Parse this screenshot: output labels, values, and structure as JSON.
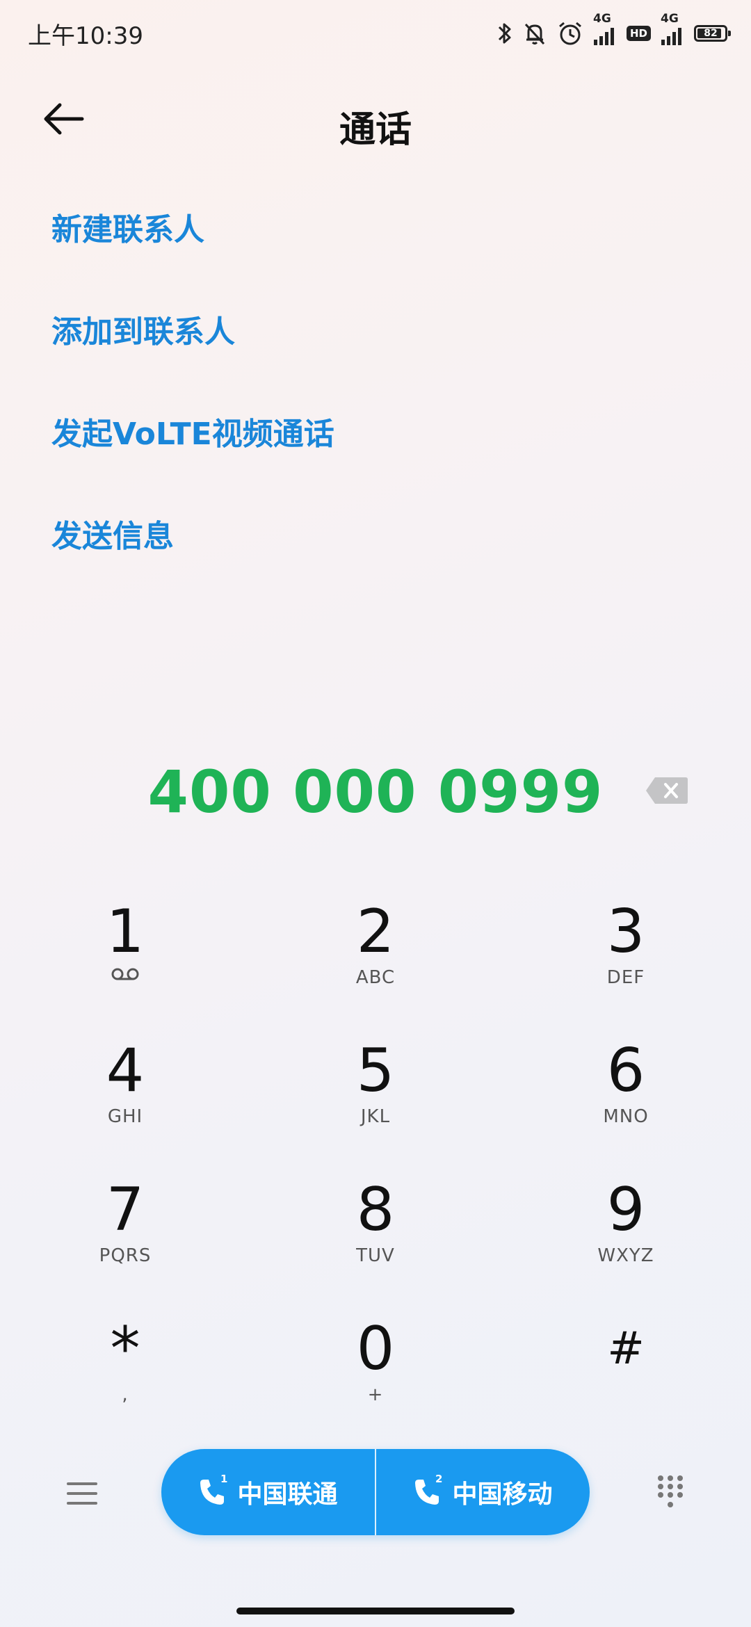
{
  "status_bar": {
    "time": "上午10:39",
    "network_1": "4G",
    "network_2": "4G",
    "hd": "HD",
    "battery": "82",
    "icons": [
      "bluetooth-icon",
      "bell-off-icon",
      "alarm-icon",
      "signal-icon",
      "hd-icon",
      "signal-icon",
      "battery-icon"
    ]
  },
  "header": {
    "title": "通话",
    "back_icon": "arrow-left-icon"
  },
  "actions": [
    {
      "label": "新建联系人"
    },
    {
      "label": "添加到联系人"
    },
    {
      "label": "发起VoLTE视频通话"
    },
    {
      "label": "发送信息"
    }
  ],
  "dialer": {
    "number": "400 000 0999",
    "delete_icon": "backspace-icon",
    "number_color": "#1fb356"
  },
  "keypad": {
    "keys": [
      {
        "digit": "1",
        "letters": "",
        "sub_icon": "voicemail-icon"
      },
      {
        "digit": "2",
        "letters": "ABC"
      },
      {
        "digit": "3",
        "letters": "DEF"
      },
      {
        "digit": "4",
        "letters": "GHI"
      },
      {
        "digit": "5",
        "letters": "JKL"
      },
      {
        "digit": "6",
        "letters": "MNO"
      },
      {
        "digit": "7",
        "letters": "PQRS"
      },
      {
        "digit": "8",
        "letters": "TUV"
      },
      {
        "digit": "9",
        "letters": "WXYZ"
      },
      {
        "digit": "*",
        "letters": ","
      },
      {
        "digit": "0",
        "letters": "+"
      },
      {
        "digit": "#",
        "letters": ""
      }
    ]
  },
  "bottom_bar": {
    "sim1_label": "中国联通",
    "sim1_index": "1",
    "sim2_label": "中国移动",
    "sim2_index": "2",
    "accent_color": "#1a9af0",
    "menu_icon": "menu-icon",
    "keypad_icon": "dialpad-icon"
  }
}
